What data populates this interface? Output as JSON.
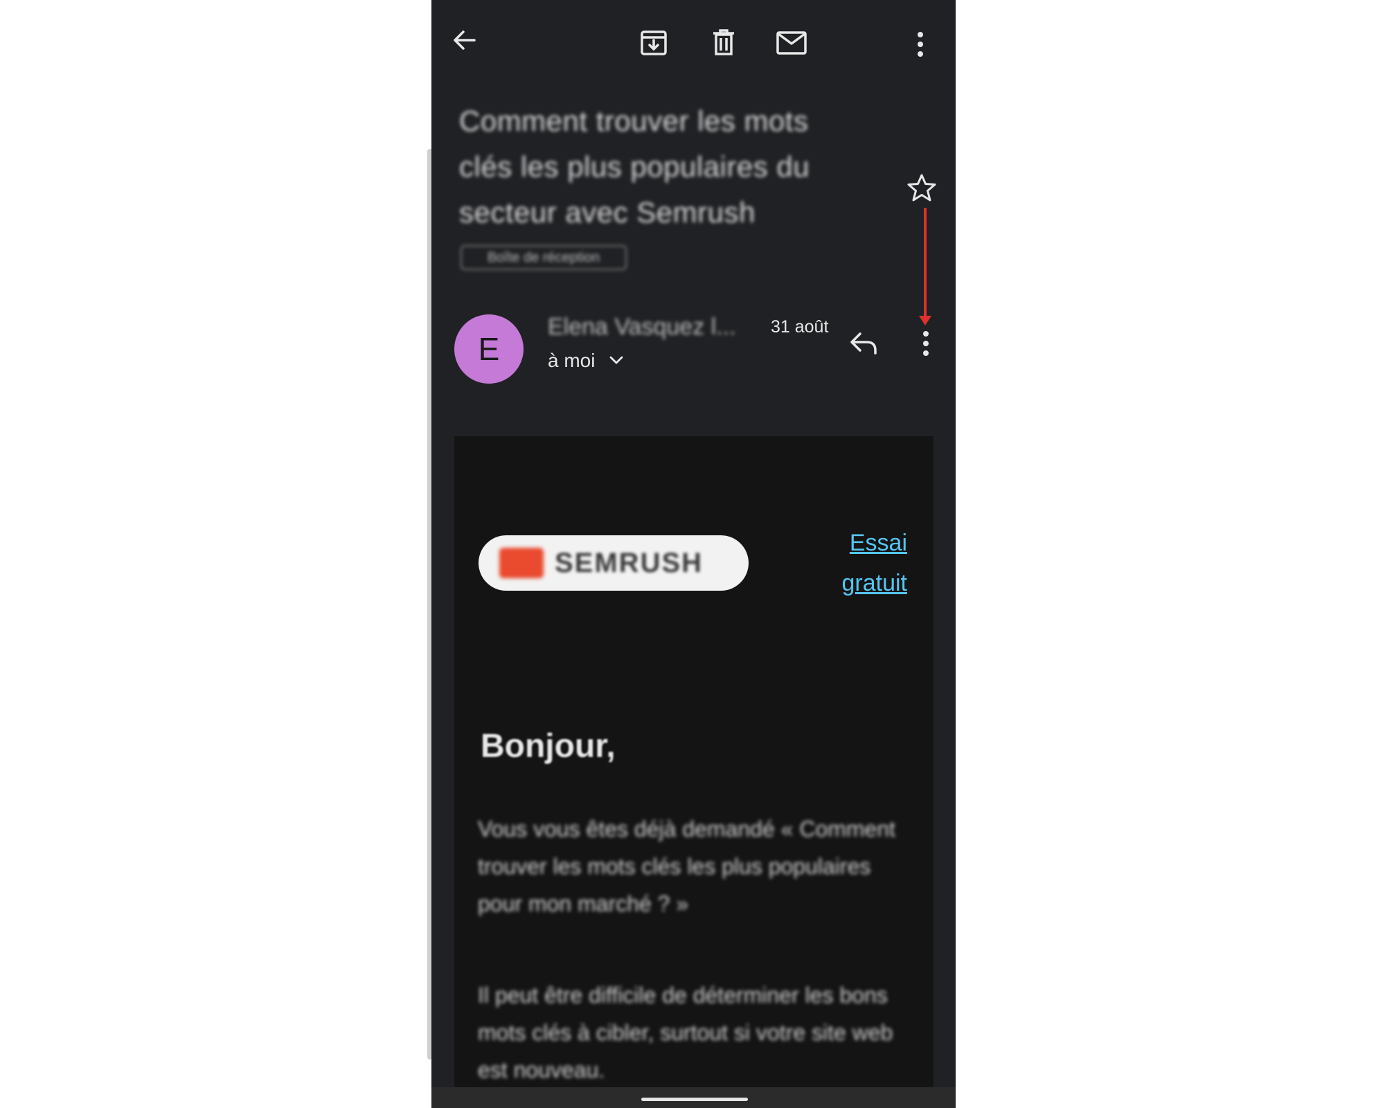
{
  "toolbar": {
    "back_icon": "arrow-left-icon",
    "archive_icon": "archive-icon",
    "delete_icon": "trash-icon",
    "mark_unread_icon": "mail-icon",
    "more_icon": "more-vertical-icon"
  },
  "email": {
    "subject": "Comment trouver les mots clés les plus populaires du secteur avec Semrush",
    "label": "Boîte de réception",
    "star_icon": "star-outline-icon",
    "sender": {
      "avatar_letter": "E",
      "avatar_color": "#c47ad6",
      "name": "Elena Vasquez l...",
      "date": "31 août",
      "recipient": "à moi"
    },
    "reply_icon": "reply-icon",
    "sender_more_icon": "more-vertical-icon"
  },
  "annotation": {
    "arrow_color": "#e0302b"
  },
  "body": {
    "logo_text": "SEMRUSH",
    "cta_line1": "Essai",
    "cta_line2": "gratuit",
    "greeting": "Bonjour,",
    "paragraph1": "Vous vous êtes déjà demandé « Comment trouver les mots clés les plus populaires pour mon marché ? »",
    "paragraph2": "Il peut être difficile de déterminer les bons mots clés à cibler, surtout si votre site web est nouveau."
  },
  "colors": {
    "background": "#202124",
    "link": "#55c5f0"
  }
}
